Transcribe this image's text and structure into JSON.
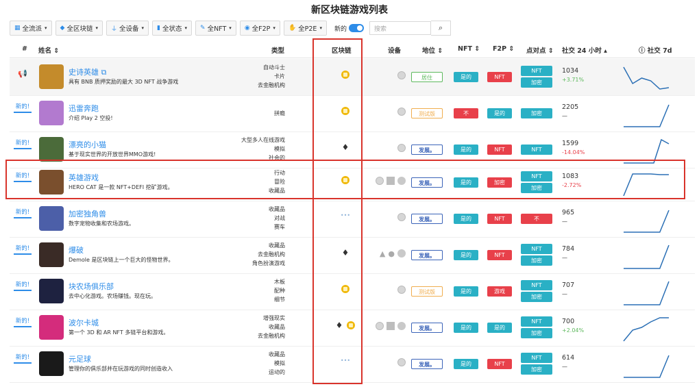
{
  "page_title": "新区块链游戏列表",
  "filters": [
    {
      "icon": "calendar-icon",
      "label": "全流派"
    },
    {
      "icon": "cube-icon",
      "label": "全区块链"
    },
    {
      "icon": "plug-icon",
      "label": "全设备"
    },
    {
      "icon": "signal-icon",
      "label": "全状态"
    },
    {
      "icon": "tag-icon",
      "label": "全NFT"
    },
    {
      "icon": "coins-icon",
      "label": "全F2P"
    },
    {
      "icon": "money-hand-icon",
      "label": "全P2E"
    }
  ],
  "new_toggle_label": "新的",
  "search_placeholder": "搜索",
  "columns": {
    "rank": "#",
    "name": "姓名 ⇕",
    "type": "类型",
    "chain": "区块链",
    "device": "设备",
    "status": "地位 ⇕",
    "nft": "NFT ⇕",
    "f2p": "F2P ⇕",
    "points": "点对点 ⇕",
    "social24": "社交 24 小时 ▴",
    "social7d": "ⓘ 社交 7d"
  },
  "rows": [
    {
      "rank_label": "",
      "name": "史诗英雄 ⧉",
      "desc": "具有 BNB 质押奖励的最大 3D NFT 战争游戏",
      "types": [
        "自动斗士",
        "卡片",
        "去金融机构"
      ],
      "chains": [
        "bnb"
      ],
      "devices": [
        "web"
      ],
      "status": "居住",
      "status_kind": "live",
      "nft": "是的",
      "f2p": "NFT",
      "f2p_kind": "red",
      "points": [
        "NFT",
        "加密"
      ],
      "points_kind": "teal",
      "social": "1034",
      "change": "+3.71%",
      "change_kind": "up",
      "spark": [
        6,
        30,
        22,
        26,
        38,
        36
      ]
    },
    {
      "rank_label": "新的!",
      "name": "迅雷奔跑",
      "desc": "介绍 Play 2 空投!",
      "types": [
        "拼瘾"
      ],
      "chains": [
        "bnb"
      ],
      "devices": [
        "web"
      ],
      "status": "测试版",
      "status_kind": "test",
      "nft": "不",
      "nft_kind": "red",
      "f2p": "是的",
      "f2p_kind": "teal",
      "points": [
        "加密"
      ],
      "points_kind": "teal",
      "social": "2205",
      "change": "—",
      "change_kind": "none",
      "spark": [
        40,
        40,
        40,
        40,
        40,
        8
      ]
    },
    {
      "rank_label": "新的!",
      "name": "漂亮的小猫",
      "desc": "基于现实世界的开放世界MMO游戏!",
      "types": [
        "大型多人在线游戏",
        "模拟",
        "社会的"
      ],
      "chains": [
        "eth"
      ],
      "devices": [
        "web"
      ],
      "status": "发展。",
      "status_kind": "dev",
      "nft": "是的",
      "f2p": "NFT",
      "f2p_kind": "red",
      "points": [
        "NFT"
      ],
      "points_kind": "teal",
      "social": "1599",
      "change": "-14.04%",
      "change_kind": "down",
      "spark": [
        40,
        40,
        40,
        40,
        40,
        6,
        12
      ]
    },
    {
      "rank_label": "新的!",
      "name": "英雄游戏",
      "desc": "HERO CAT 是一款 NFT+DEFI 挖矿游戏。",
      "types": [
        "行动",
        "冒险",
        "收藏品"
      ],
      "chains": [
        "bnb"
      ],
      "devices": [
        "web",
        "windows",
        "mac"
      ],
      "status": "发展。",
      "status_kind": "dev",
      "nft": "是的",
      "f2p": "加密",
      "f2p_kind": "red",
      "points": [
        "NFT",
        "加密"
      ],
      "points_kind": "teal",
      "social": "1083",
      "change": "-2.72%",
      "change_kind": "down",
      "spark": [
        40,
        8,
        8,
        8,
        9,
        9
      ]
    },
    {
      "rank_label": "新的!",
      "name": "加密独角兽",
      "desc": "数字宠物收集和农场游戏。",
      "types": [
        "收藏品",
        "对战",
        "赛车"
      ],
      "chains": [
        "dots"
      ],
      "devices": [
        "web"
      ],
      "status": "发展。",
      "status_kind": "dev",
      "nft": "是的",
      "f2p": "NFT",
      "f2p_kind": "red",
      "points": [
        "不"
      ],
      "points_kind": "red",
      "social": "965",
      "change": "—",
      "change_kind": "none",
      "spark": [
        40,
        40,
        40,
        40,
        40,
        8
      ]
    },
    {
      "rank_label": "新的!",
      "name": "爆破",
      "desc": "Demole 是区块链上一个巨大的怪物世界。",
      "types": [
        "收藏品",
        "去金融机构",
        "角色扮演游戏"
      ],
      "chains": [
        "eth"
      ],
      "devices": [
        "android",
        "apple",
        "mac"
      ],
      "status": "发展。",
      "status_kind": "dev",
      "nft": "是的",
      "f2p": "NFT",
      "f2p_kind": "red",
      "points": [
        "NFT",
        "加密"
      ],
      "points_kind": "teal",
      "social": "784",
      "change": "—",
      "change_kind": "none",
      "spark": [
        40,
        40,
        40,
        40,
        40,
        6
      ]
    },
    {
      "rank_label": "新的!",
      "name": "块农场俱乐部",
      "desc": "去中心化游戏。农场赚钱。现在玩。",
      "types": [
        "木板",
        "配种",
        "细节"
      ],
      "chains": [
        "bnb"
      ],
      "devices": [
        "web"
      ],
      "status": "测试版",
      "status_kind": "test",
      "nft": "是的",
      "f2p": "游戏",
      "f2p_kind": "red",
      "points": [
        "NFT",
        "加密"
      ],
      "points_kind": "teal",
      "social": "707",
      "change": "—",
      "change_kind": "none",
      "spark": [
        40,
        40,
        40,
        40,
        40,
        6
      ]
    },
    {
      "rank_label": "新的!",
      "name": "波尔卡城",
      "desc": "第一个 3D 和 AR NFT 多链平台和游戏。",
      "types": [
        "增强现实",
        "收藏品",
        "去金融机构"
      ],
      "chains": [
        "eth",
        "bnb"
      ],
      "devices": [
        "web",
        "windows",
        "mac"
      ],
      "status": "发展。",
      "status_kind": "dev",
      "nft": "是的",
      "f2p": "是的",
      "f2p_kind": "teal",
      "points": [
        "NFT",
        "加密"
      ],
      "points_kind": "teal",
      "social": "700",
      "change": "+2.04%",
      "change_kind": "up",
      "spark": [
        40,
        24,
        20,
        12,
        6,
        6
      ]
    },
    {
      "rank_label": "新的!",
      "name": "元足球",
      "desc": "管理你的俱乐部并在玩游戏的同时创造收入",
      "types": [
        "收藏品",
        "模拟",
        "运动的"
      ],
      "chains": [
        "dots"
      ],
      "devices": [
        "web"
      ],
      "status": "发展。",
      "status_kind": "dev",
      "nft": "是的",
      "f2p": "NFT",
      "f2p_kind": "red",
      "points": [
        "NFT",
        "加密"
      ],
      "points_kind": "teal",
      "social": "614",
      "change": "—",
      "change_kind": "none",
      "spark": [
        40,
        40,
        40,
        40,
        40,
        8
      ]
    }
  ],
  "thumb_colors": [
    "#c48b2b",
    "#b27acf",
    "#4b6b3a",
    "#7a4f2d",
    "#4c5fa8",
    "#3a2b26",
    "#1e2240",
    "#d42c7c",
    "#1a1a1a"
  ]
}
